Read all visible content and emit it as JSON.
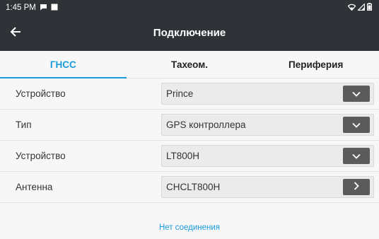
{
  "status_bar": {
    "time": "1:45 PM"
  },
  "app_bar": {
    "title": "Подключение",
    "back_icon": "arrow-left-icon"
  },
  "tabs": [
    {
      "label": "ГНСС",
      "active": true
    },
    {
      "label": "Тахеом.",
      "active": false
    },
    {
      "label": "Периферия",
      "active": false
    }
  ],
  "rows": [
    {
      "label": "Устройство",
      "value": "Prince",
      "button_icon": "chevron-down-icon"
    },
    {
      "label": "Тип",
      "value": "GPS контроллера",
      "button_icon": "chevron-down-icon"
    },
    {
      "label": "Устройство",
      "value": "LT800H",
      "button_icon": "chevron-down-icon"
    },
    {
      "label": "Антенна",
      "value": "CHCLT800H",
      "button_icon": "chevron-right-icon"
    }
  ],
  "connection_status": "Нет соединения",
  "colors": {
    "bar_bg": "#2f3337",
    "accent": "#1b9bdc",
    "button_bg": "#5b5b5b"
  }
}
